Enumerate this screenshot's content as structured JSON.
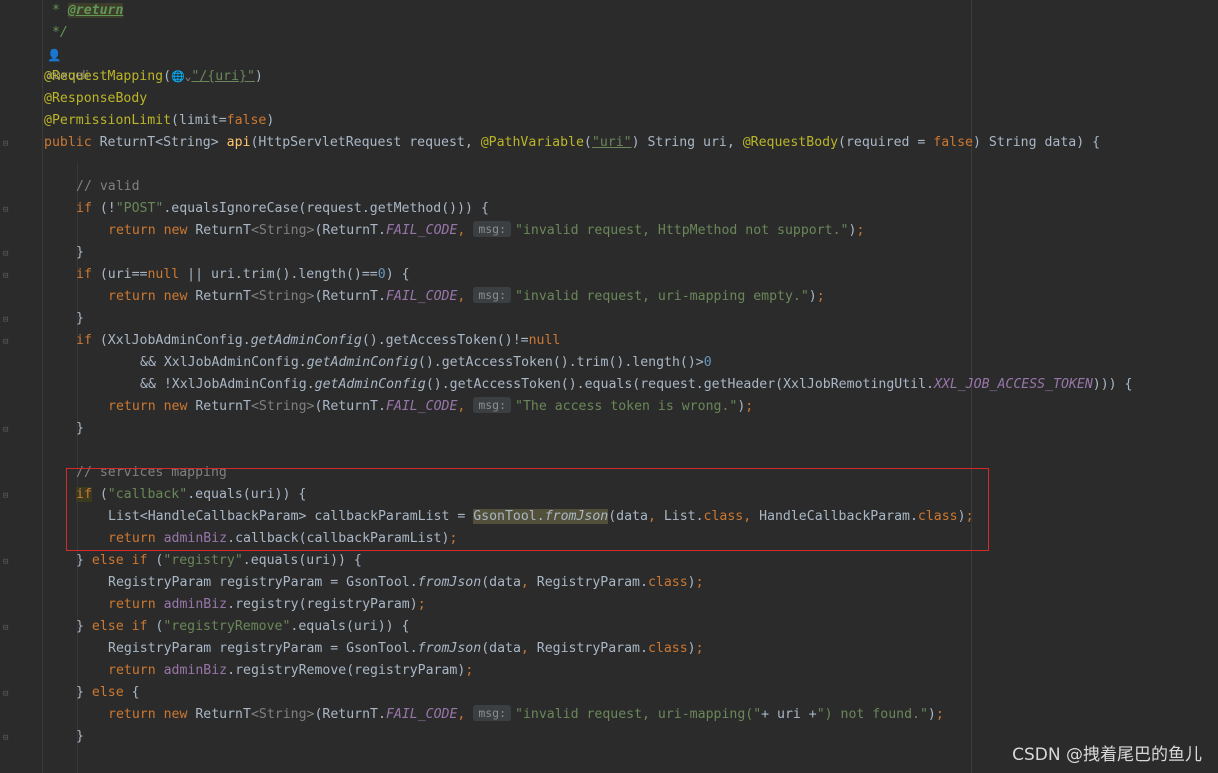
{
  "editor": {
    "doc_return_tag": "@return",
    "author": "xuxueli",
    "watermark": "CSDN @拽着尾巴的鱼儿",
    "hints": {
      "msg": "msg:"
    }
  },
  "code": {
    "l1_prefix": " * ",
    "l2": " */",
    "mapping_ann": "@RequestMapping",
    "mapping_val": "\"/{uri}\"",
    "response_body": "@ResponseBody",
    "perm_ann": "@PermissionLimit",
    "perm_args": "limit=",
    "perm_false": "false",
    "sig_public": "public",
    "sig_ret": " ReturnT<String> ",
    "sig_name": "api",
    "sig_p1": "(HttpServletRequest request, ",
    "sig_pv": "@PathVariable",
    "sig_pv_val": "\"uri\"",
    "sig_p2": ") String uri, ",
    "sig_rb": "@RequestBody",
    "sig_rb_args": "(required = ",
    "sig_rb_false": "false",
    "sig_end": ") String data) {",
    "c_valid": "// valid",
    "c_services": "// services mapping",
    "s_post": "\"POST\"",
    "s_invalid1": "\"invalid request, HttpMethod not support.\"",
    "s_invalid2": "\"invalid request, uri-mapping empty.\"",
    "s_token": "\"The access token is wrong.\"",
    "s_callback": "\"callback\"",
    "s_registry": "\"registry\"",
    "s_registry_remove": "\"registryRemove\"",
    "s_notfound_a": "\"invalid request, uri-mapping(\"",
    "s_notfound_b": "\") not found.\""
  }
}
